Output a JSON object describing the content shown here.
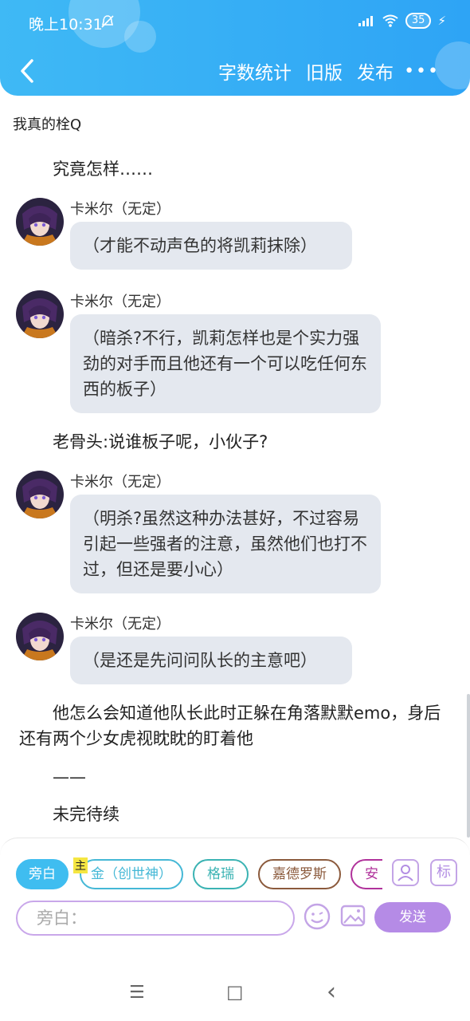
{
  "status_bar": {
    "time": "晚上10:31",
    "battery": "35"
  },
  "nav": {
    "word_count": "字数统计",
    "old_version": "旧版",
    "publish": "发布",
    "more": "•••"
  },
  "book_title": "我真的栓Q",
  "narration": [
    "究竟怎样……",
    "老骨头:说谁板子呢，小伙子?",
    "他怎么会知道他队长此时正躲在角落默默emo，身后还有两个少女虎视眈眈的盯着他",
    "——",
    "未完待续"
  ],
  "messages": [
    {
      "speaker": "卡米尔（无定）",
      "text": "（才能不动声色的将凯莉抹除）"
    },
    {
      "speaker": "卡米尔（无定）",
      "text": "（暗杀?不行，凯莉怎样也是个实力强劲的对手而且他还有一个可以吃任何东西的板子）"
    },
    {
      "speaker": "卡米尔（无定）",
      "text": "（明杀?虽然这种办法甚好，不过容易引起一些强者的注意，虽然他们也打不过，但还是要小心）"
    },
    {
      "speaker": "卡米尔（无定）",
      "text": "（是还是先问问队长的主意吧）"
    }
  ],
  "composer": {
    "main_tag": "主",
    "chips": [
      {
        "label": "旁白",
        "color": "#3fbdf0"
      },
      {
        "label": "金（创世神）",
        "color": "#45b8d6"
      },
      {
        "label": "格瑞",
        "color": "#3bb3b3"
      },
      {
        "label": "嘉德罗斯",
        "color": "#8b5a3c"
      },
      {
        "label": "安",
        "color": "#b0329b"
      }
    ],
    "tag_button": "标",
    "input_placeholder": "旁白：",
    "send_label": "发送"
  },
  "system_nav": {
    "menu": "☰",
    "home": "☐",
    "back": "‹"
  }
}
